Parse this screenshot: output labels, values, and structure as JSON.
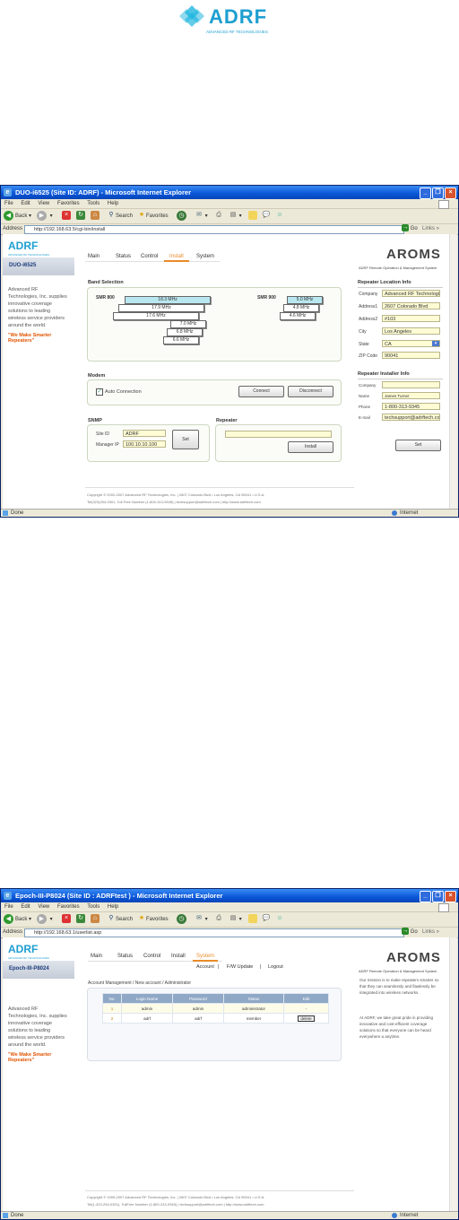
{
  "doc_logo": {
    "brand": "ADRF",
    "tagline": "ADVANCED RF TECHNOLOGIES"
  },
  "common": {
    "menu": [
      "File",
      "Edit",
      "View",
      "Favorites",
      "Tools",
      "Help"
    ],
    "toolbar": {
      "back": "Back",
      "search": "Search",
      "favorites": "Favorites"
    },
    "address_label": "Address",
    "go": "Go",
    "links": "Links",
    "status_done": "Done",
    "status_zone": "Internet",
    "brand": "ADRF",
    "brand_sub": "ADVANCED RF TECHNOLOGIES",
    "aroms": "AROMS",
    "aroms_sub": "ADRF Remote Operation & Management System",
    "left_text": "Advanced RF Technologies, Inc. supplies innovative coverage solutions to leading wireless service providers around the world.",
    "slogan": "\"We Make Smarter Repeaters\"",
    "tabs": [
      "Main",
      "Status",
      "Control",
      "Install",
      "System"
    ]
  },
  "shot1": {
    "window_title": "DUO-i6525 (Site ID: ADRF) - Microsoft Internet Explorer",
    "url": "http://192.168.63.5/cgi-bin/install",
    "site": "DUO-i6525",
    "active_tab": "Install",
    "band_selection": "Band Selection",
    "smr800_label": "SMR 800",
    "smr800_bands": [
      "18.3 MHz",
      "17.9 MHz",
      "17.6 MHz",
      "7.0 MHz",
      "6.8 MHz",
      "6.6 MHz"
    ],
    "smr900_label": "SMR 900",
    "smr900_bands": [
      "5.0 MHz",
      "4.8 MHz",
      "4.6 MHz"
    ],
    "modem": "Modem",
    "auto_connection": "Auto Connection",
    "connect": "Connect",
    "disconnect": "Disconnect",
    "snmp": "SNMP",
    "site_id_label": "Site ID",
    "site_id_value": "ADRF",
    "manager_ip_label": "Manager IP",
    "manager_ip_value": "100.10.10.100",
    "set": "Set",
    "repeater": "Repeater",
    "install": "Install",
    "location_title": "Repeater Location Info",
    "location_fields": [
      {
        "label": "Company",
        "value": "Advanced RF Technologies"
      },
      {
        "label": "Address1",
        "value": "2607 Colorado Blvd"
      },
      {
        "label": "Address2",
        "value": "#103"
      },
      {
        "label": "City",
        "value": "Los Angeles"
      },
      {
        "label": "State",
        "value": "CA"
      },
      {
        "label": "ZIP Code",
        "value": "90041"
      }
    ],
    "installer_title": "Repeater Installer Info",
    "installer_fields": [
      {
        "label": "Company",
        "value": ""
      },
      {
        "label": "Name",
        "value": "James Turner"
      },
      {
        "label": "Phone",
        "value": "1-800-313-9345"
      },
      {
        "label": "E-mail",
        "value": "techsupport@adrftech.com"
      }
    ],
    "footer1": "Copyright © 2002-2007 Advanced RF Technologies, Inc. | 2607 Colorado Blvd • Los Angeles, CA 90041 • U.S.A.",
    "footer2": "Tel(323)254-0301. Toll Free Number (1-800-313-9345) | techsupport@adrftech.com | http://www.adrftech.com"
  },
  "shot2": {
    "window_title": "Epoch-III-P8024 (Site ID : ADRFtest ) - Microsoft Internet Explorer",
    "url": "http://192.168.63.1/userlist.asp",
    "site": "Epoch-III-P8024",
    "active_tab": "System",
    "subnav": [
      "Account",
      "F/W Update",
      "Logout"
    ],
    "breadcrumb": "Account Management / New account / Administrator",
    "table_headers": [
      "No.",
      "Login Name",
      "Password",
      "Status",
      "Edit"
    ],
    "rows": [
      [
        "1",
        "admin",
        "admin",
        "administrator",
        "-"
      ],
      [
        "2",
        "adrf",
        "adrf",
        "member",
        "delete"
      ]
    ],
    "mission1": "Our mission is to make repeaters smarter so that they can seamlessly and flawlessly be integrated into wireless networks.",
    "mission2": "At ADRF, we take great pride in providing innovative and cost-efficient coverage solutions so that everyone can be heard everywhere a anytime.",
    "footer1": "Copyright © 1999-2007 Advanced RF Technologies, Inc. | 2607 Colorado Blvd • Los Angeles, CA 90041 • U.S.A.",
    "footer2": "Tel(1-323-254-0301), TollFree Number (1-800-313-9345) | techsupport@adrftech.com | http://www.adrftech.com"
  }
}
